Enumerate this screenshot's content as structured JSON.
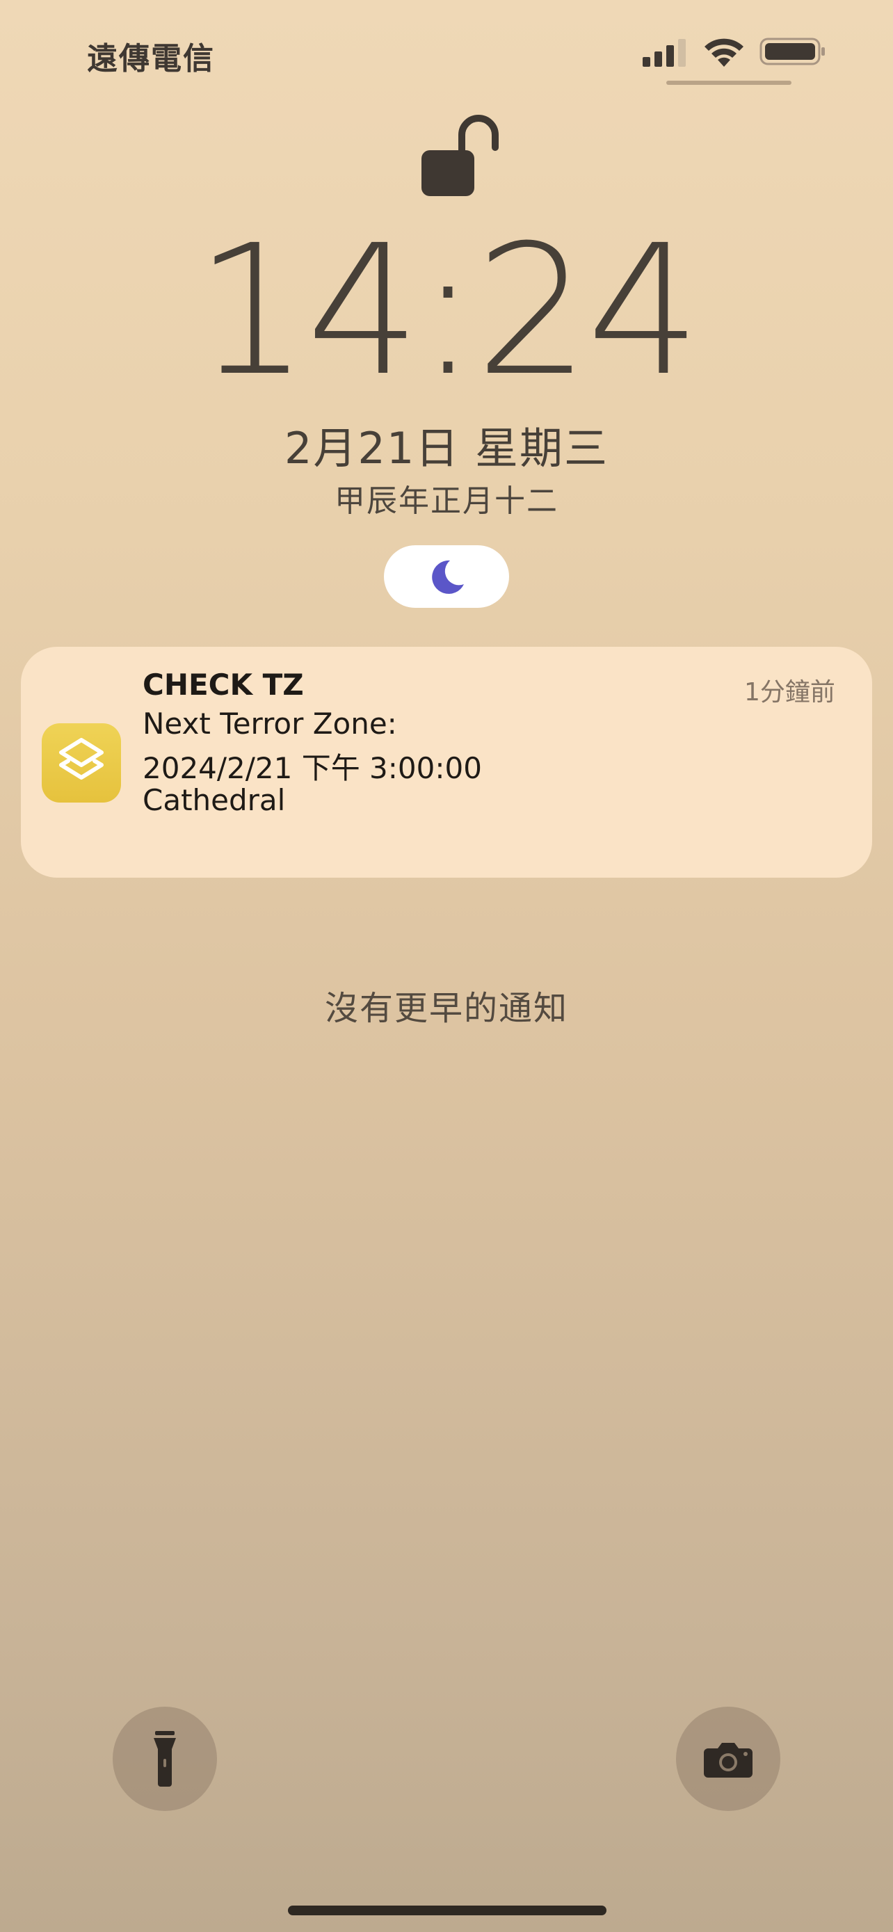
{
  "status_bar": {
    "carrier": "遠傳電信",
    "signal_icon": "cellular-signal-icon",
    "wifi_icon": "wifi-icon",
    "battery_icon": "battery-icon"
  },
  "lock": {
    "icon": "unlocked-padlock-icon"
  },
  "lock_screen": {
    "time": "14:24",
    "date": "2月21日 星期三",
    "lunar_date": "甲辰年正月十二"
  },
  "focus": {
    "icon": "moon-icon",
    "accent_color": "#5b56c8"
  },
  "notification": {
    "app_icon": "shortcuts-app-icon",
    "app_icon_color": "#e8c845",
    "title": "CHECK TZ",
    "time_ago": "1分鐘前",
    "body_lines": [
      "Next Terror Zone:",
      "2024/2/21 下午 3:00:00",
      "Cathedral"
    ]
  },
  "no_older_notifications": "沒有更早的通知",
  "bottom_controls": {
    "flashlight_icon": "flashlight-icon",
    "camera_icon": "camera-icon"
  }
}
